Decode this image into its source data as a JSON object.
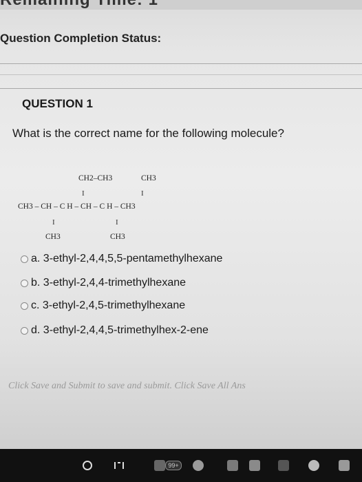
{
  "header": {
    "remaining_time_partial": "Remaining Time: 1",
    "completion_status_label": "Question Completion Status:"
  },
  "question": {
    "title": "QUESTION 1",
    "text": "What is the correct name for the following molecule?"
  },
  "molecule": {
    "top_substituents": [
      "CH2–CH3",
      "CH3"
    ],
    "main_chain": "CH3 – CH – C H – CH – C H – CH3",
    "bottom_substituents": [
      "CH3",
      "CH3"
    ],
    "bond_mark": "I"
  },
  "options": [
    {
      "letter": "a.",
      "label": "3-ethyl-2,4,4,5,5-pentamethylhexane"
    },
    {
      "letter": "b.",
      "label": "3-ethyl-2,4,4-trimethylhexane"
    },
    {
      "letter": "c.",
      "label": "3-ethyl-2,4,5-trimethylhexane"
    },
    {
      "letter": "d.",
      "label": "3-ethyl-2,4,4,5-trimethylhex-2-ene"
    }
  ],
  "footer": {
    "note": "Click Save and Submit to save and submit. Click Save All Ans"
  },
  "navbar": {
    "home_icon": "circle-home-icon",
    "recents_icon": "recents-icon",
    "badge": "99+"
  }
}
